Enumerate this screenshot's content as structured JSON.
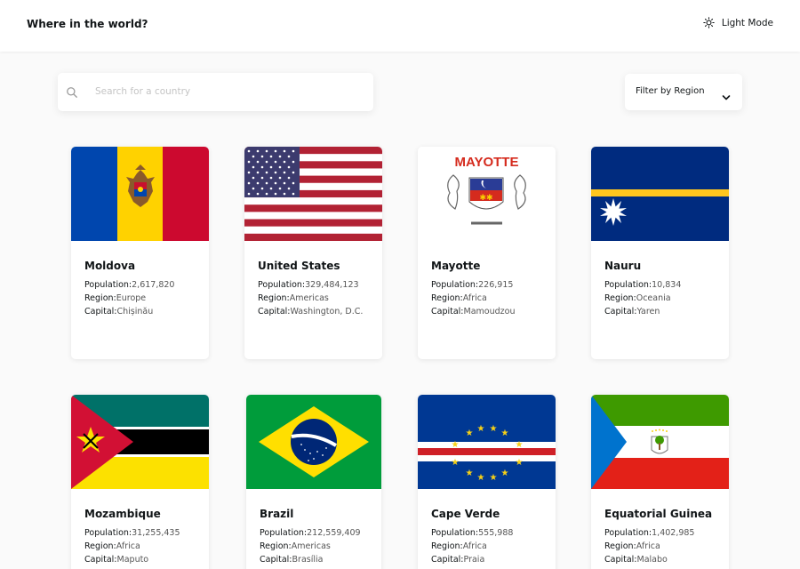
{
  "header": {
    "title": "Where in the world?",
    "mode_label": "Light Mode",
    "mode_icon": "sun-icon"
  },
  "search": {
    "placeholder": "Search for a country",
    "value": "",
    "icon": "search-icon"
  },
  "filter": {
    "label": "Filter by Region",
    "icon": "chevron-down-icon"
  },
  "labels": {
    "population": "Population:",
    "region": "Region:",
    "capital": "Capital:"
  },
  "countries": [
    {
      "name": "Moldova",
      "population": "2,617,820",
      "region": "Europe",
      "capital": "Chișinău"
    },
    {
      "name": "United States",
      "population": "329,484,123",
      "region": "Americas",
      "capital": "Washington, D.C."
    },
    {
      "name": "Mayotte",
      "population": "226,915",
      "region": "Africa",
      "capital": "Mamoudzou",
      "flag_text": "MAYOTTE"
    },
    {
      "name": "Nauru",
      "population": "10,834",
      "region": "Oceania",
      "capital": "Yaren"
    },
    {
      "name": "Mozambique",
      "population": "31,255,435",
      "region": "Africa",
      "capital": "Maputo"
    },
    {
      "name": "Brazil",
      "population": "212,559,409",
      "region": "Americas",
      "capital": "Brasília"
    },
    {
      "name": "Cape Verde",
      "population": "555,988",
      "region": "Africa",
      "capital": "Praia"
    },
    {
      "name": "Equatorial Guinea",
      "population": "1,402,985",
      "region": "Africa",
      "capital": "Malabo"
    }
  ]
}
